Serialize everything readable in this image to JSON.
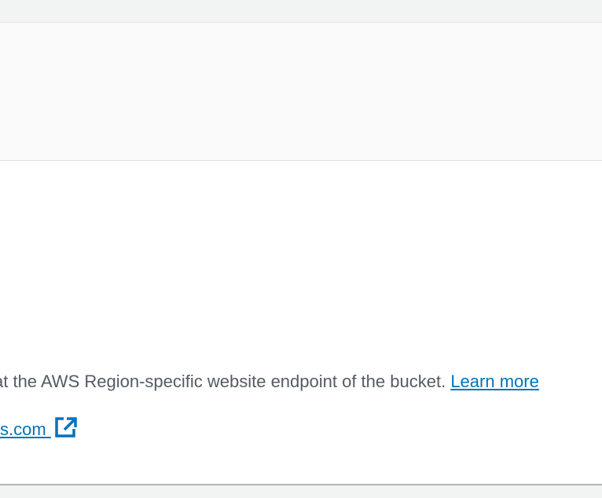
{
  "static_website_hosting": {
    "description": "at the AWS Region-specific website endpoint of the bucket.",
    "learn_more": "Learn more",
    "endpoint_url_tail": "s.com"
  },
  "icons": {
    "endpoint_external": "external-link-icon"
  },
  "colors": {
    "link": "#0073bb",
    "body_text": "#545b64",
    "header_bg": "#fafafa",
    "page_bg": "#f2f3f3"
  }
}
